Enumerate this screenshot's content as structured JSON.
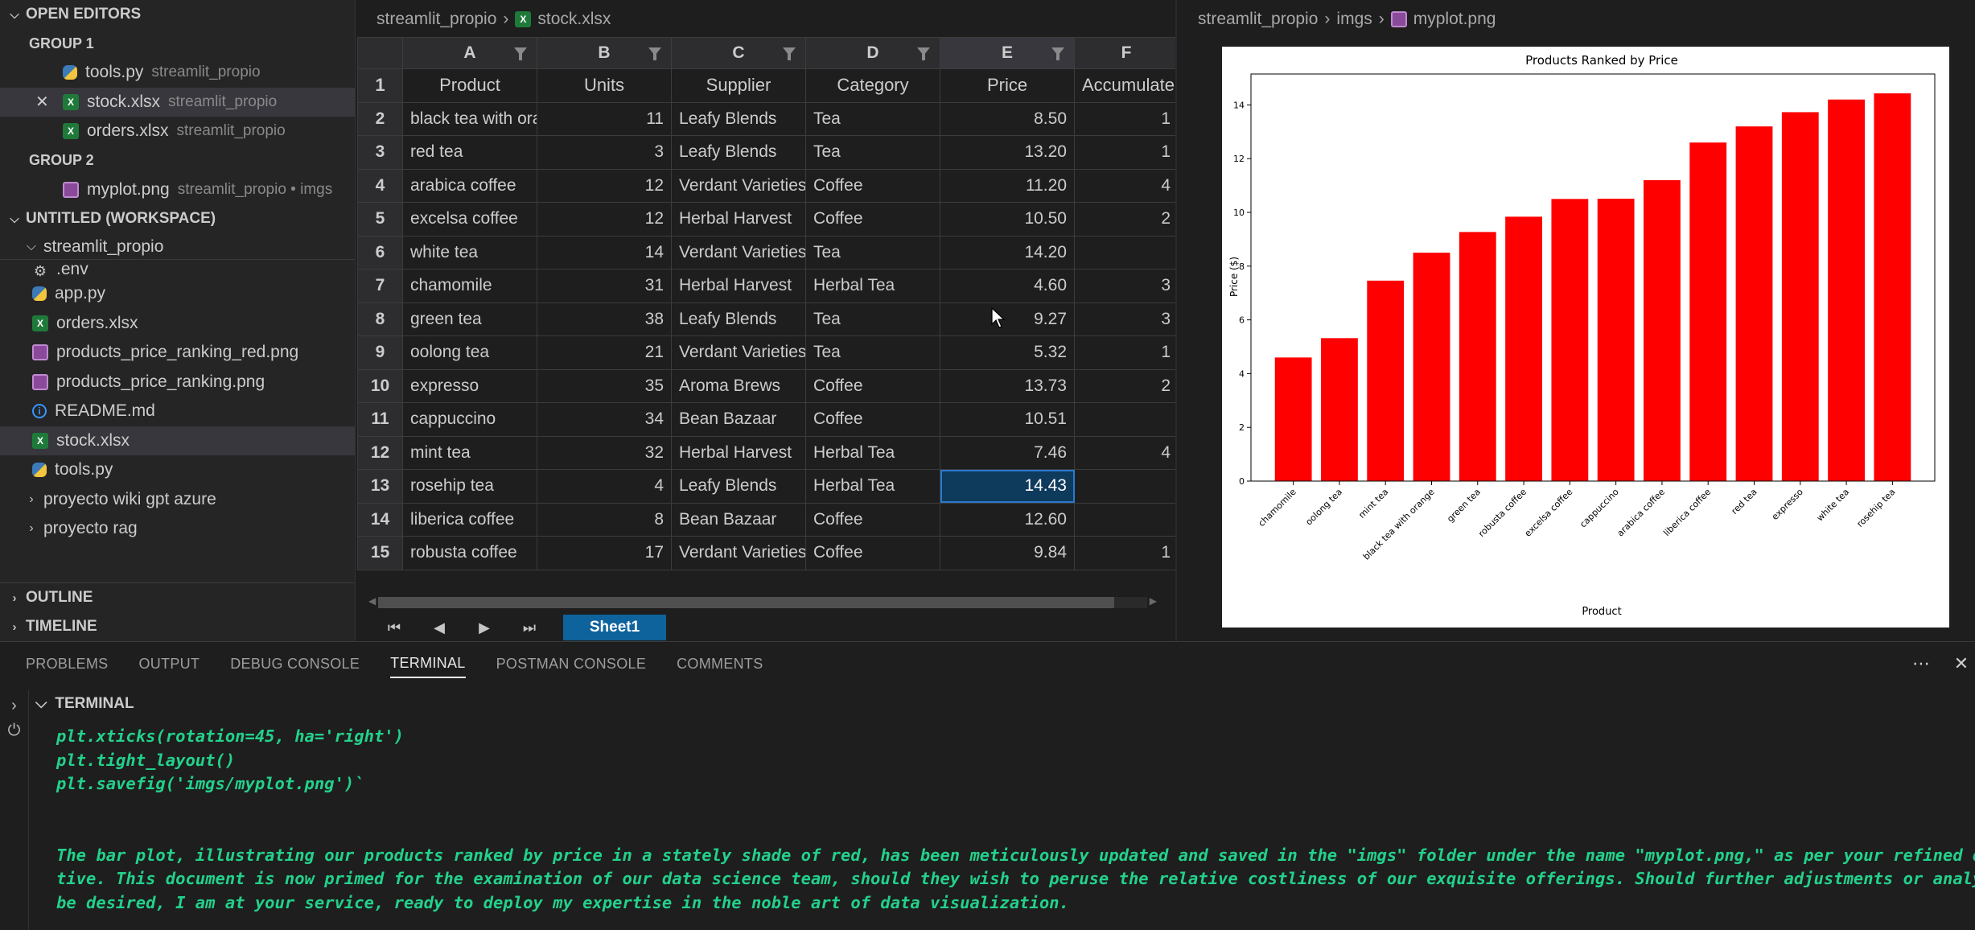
{
  "sidebar": {
    "open_editors_title": "OPEN EDITORS",
    "groups": [
      {
        "label": "GROUP 1",
        "items": [
          {
            "name": "tools.py",
            "desc": "streamlit_propio",
            "icon": "python-file-icon"
          },
          {
            "name": "stock.xlsx",
            "desc": "streamlit_propio",
            "icon": "excel-file-icon"
          },
          {
            "name": "orders.xlsx",
            "desc": "streamlit_propio",
            "icon": "excel-file-icon"
          }
        ]
      },
      {
        "label": "GROUP 2",
        "items": [
          {
            "name": "myplot.png",
            "desc": "streamlit_propio • imgs",
            "icon": "image-file-icon"
          }
        ]
      }
    ],
    "workspace_title": "UNTITLED (WORKSPACE)",
    "folder": "streamlit_propio",
    "files": [
      ".env",
      "app.py",
      "orders.xlsx",
      "products_price_ranking_red.png",
      "products_price_ranking.png",
      "README.md",
      "stock.xlsx",
      "tools.py"
    ],
    "folders": [
      "proyecto wiki gpt azure",
      "proyecto rag"
    ],
    "outline_title": "OUTLINE",
    "timeline_title": "TIMELINE"
  },
  "sheet": {
    "breadcrumb": [
      "streamlit_propio",
      "stock.xlsx"
    ],
    "columns": [
      "A",
      "B",
      "C",
      "D",
      "E",
      "F"
    ],
    "header_row": [
      "Product",
      "Units",
      "Supplier",
      "Category",
      "Price",
      "Accumulated"
    ],
    "rows": [
      [
        "black tea with orange",
        "11",
        "Leafy Blends",
        "Tea",
        "8.50",
        "1"
      ],
      [
        "red tea",
        "3",
        "Leafy Blends",
        "Tea",
        "13.20",
        "1"
      ],
      [
        "arabica coffee",
        "12",
        "Verdant Varieties",
        "Coffee",
        "11.20",
        "4"
      ],
      [
        "excelsa coffee",
        "12",
        "Herbal Harvest",
        "Coffee",
        "10.50",
        "2"
      ],
      [
        "white tea",
        "14",
        "Verdant Varieties",
        "Tea",
        "14.20",
        ""
      ],
      [
        "chamomile",
        "31",
        "Herbal Harvest",
        "Herbal Tea",
        "4.60",
        "3"
      ],
      [
        "green tea",
        "38",
        "Leafy Blends",
        "Tea",
        "9.27",
        "3"
      ],
      [
        "oolong tea",
        "21",
        "Verdant Varieties",
        "Tea",
        "5.32",
        "1"
      ],
      [
        "expresso",
        "35",
        "Aroma Brews",
        "Coffee",
        "13.73",
        "2"
      ],
      [
        "cappuccino",
        "34",
        "Bean Bazaar",
        "Coffee",
        "10.51",
        ""
      ],
      [
        "mint tea",
        "32",
        "Herbal Harvest",
        "Herbal Tea",
        "7.46",
        "4"
      ],
      [
        "rosehip tea",
        "4",
        "Leafy Blends",
        "Herbal Tea",
        "14.43",
        ""
      ],
      [
        "liberica coffee",
        "8",
        "Bean Bazaar",
        "Coffee",
        "12.60",
        ""
      ],
      [
        "robusta coffee",
        "17",
        "Verdant Varieties",
        "Coffee",
        "9.84",
        "1"
      ]
    ],
    "active_cell": "E13",
    "sheet_tab": "Sheet1"
  },
  "image": {
    "breadcrumb": [
      "streamlit_propio",
      "imgs",
      "myplot.png"
    ]
  },
  "chart_data": {
    "type": "bar",
    "title": "Products Ranked by Price",
    "xlabel": "Product",
    "ylabel": "Price ($)",
    "categories": [
      "chamomile",
      "oolong tea",
      "mint tea",
      "black tea with orange",
      "green tea",
      "robusta coffee",
      "excelsa coffee",
      "cappuccino",
      "arabica coffee",
      "liberica coffee",
      "red tea",
      "expresso",
      "white tea",
      "rosehip tea"
    ],
    "values": [
      4.6,
      5.32,
      7.46,
      8.5,
      9.27,
      9.84,
      10.5,
      10.51,
      11.2,
      12.6,
      13.2,
      13.73,
      14.2,
      14.43
    ],
    "yticks": [
      0,
      2,
      4,
      6,
      8,
      10,
      12,
      14
    ],
    "ylim": [
      0,
      15.15
    ],
    "bar_color": "#ff0000"
  },
  "panel": {
    "tabs": [
      "PROBLEMS",
      "OUTPUT",
      "DEBUG CONSOLE",
      "TERMINAL",
      "POSTMAN CONSOLE",
      "COMMENTS"
    ],
    "active_tab": "TERMINAL",
    "terminal_title": "TERMINAL",
    "lines": [
      "plt.xticks(rotation=45, ha='right')",
      "plt.tight_layout()",
      "plt.savefig('imgs/myplot.png')`",
      "",
      "",
      "The bar plot, illustrating our products ranked by price in a stately shade of red, has been meticulously updated and saved in the \"imgs\" folder under the name \"myplot.png,\" as per your refined direc",
      "tive. This document is now primed for the examination of our data science team, should they wish to peruse the relative costliness of our exquisite offerings. Should further adjustments or analyses",
      "be desired, I am at your service, ready to deploy my expertise in the noble art of data visualization."
    ]
  }
}
